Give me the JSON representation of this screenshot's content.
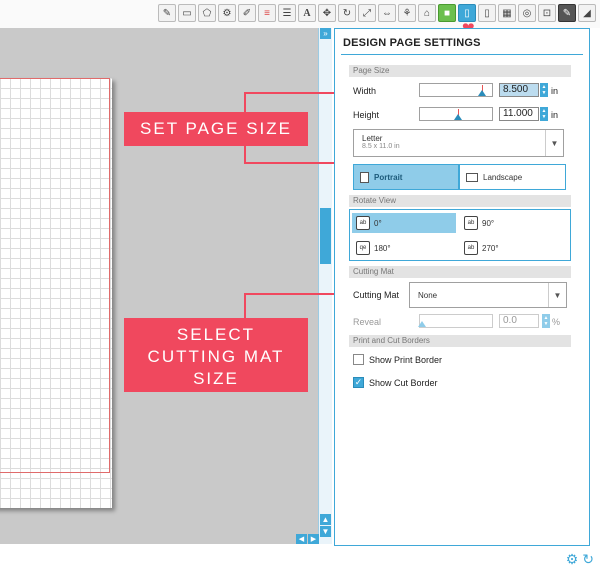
{
  "toolbar": {
    "icons": [
      "eraser-icon",
      "panel-icon",
      "shape-icon",
      "replicate-icon",
      "pencil-icon",
      "lines-icon",
      "fill-icon",
      "text-icon",
      "transform-icon",
      "rotate-icon",
      "scale-icon",
      "move-icon",
      "align-icon",
      "knife-icon",
      "trace-icon",
      "library-icon",
      "page-settings-icon",
      "grid-icon",
      "registration-icon",
      "cut-settings-icon",
      "send-icon"
    ],
    "text_icon_glyph": "A"
  },
  "callouts": {
    "page_size": "SET PAGE SIZE",
    "cutting_mat": "SELECT CUTTING MAT SIZE"
  },
  "panel": {
    "title": "DESIGN PAGE SETTINGS",
    "sections": {
      "page_size": "Page Size",
      "rotate_view": "Rotate View",
      "cutting_mat": "Cutting Mat",
      "print_cut_borders": "Print and Cut Borders"
    },
    "width": {
      "label": "Width",
      "value": "8.500",
      "unit": "in"
    },
    "height": {
      "label": "Height",
      "value": "11.000",
      "unit": "in"
    },
    "paper": {
      "name": "Letter",
      "size": "8.5 x 11.0 in"
    },
    "orientation": {
      "portrait": "Portrait",
      "landscape": "Landscape",
      "selected": "Portrait"
    },
    "rotate": {
      "r0": "0°",
      "r90": "90°",
      "r180": "180°",
      "r270": "270°",
      "selected": "0°"
    },
    "cutting_mat": {
      "label": "Cutting Mat",
      "value": "None"
    },
    "reveal": {
      "label": "Reveal",
      "value": "0.0",
      "unit": "%"
    },
    "borders": {
      "show_print": "Show Print Border",
      "show_cut": "Show Cut Border",
      "print_checked": false,
      "cut_checked": true
    }
  },
  "colors": {
    "accent": "#3fa8d8",
    "callout": "#f0485e"
  }
}
